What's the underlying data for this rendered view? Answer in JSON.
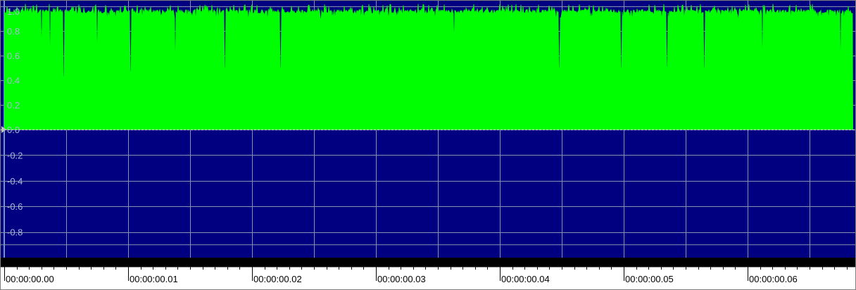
{
  "colors": {
    "background": "#000080",
    "waveform": "#00ff00",
    "grid": "#8890b0",
    "axis_label": "#a8b8d8",
    "ruler_bg": "#ffffff",
    "ruler_text": "#000000",
    "bar": "#000000"
  },
  "chart_data": {
    "type": "area",
    "ylim": [
      -1.0,
      1.0
    ],
    "xlim_seconds": [
      0.0,
      0.0685
    ],
    "y_ticks": [
      "1.0",
      "0.8",
      "0.6",
      "0.4",
      "0.2",
      "0.0",
      "-0.2",
      "-0.4",
      "-0.6",
      "-0.8"
    ],
    "y_tick_values": [
      1.0,
      0.8,
      0.6,
      0.4,
      0.2,
      0.0,
      -0.2,
      -0.4,
      -0.6,
      -0.8
    ],
    "x_ticks": [
      "00:00:00.00",
      "00:00:00.01",
      "00:00:00.02",
      "00:00:00.03",
      "00:00:00.04",
      "00:00:00.05",
      "00:00:00.06"
    ],
    "x_tick_values": [
      0.0,
      0.01,
      0.02,
      0.03,
      0.04,
      0.05,
      0.06
    ],
    "grid": true,
    "series": [
      {
        "values_note": "",
        "baseline": 0.0,
        "typical_level": 0.96,
        "dips": [
          {
            "t": 0.003,
            "v": 0.6
          },
          {
            "t": 0.0037,
            "v": 0.48
          },
          {
            "t": 0.0048,
            "v": 0.43
          },
          {
            "t": 0.0075,
            "v": 0.53
          },
          {
            "t": 0.0102,
            "v": 0.47
          },
          {
            "t": 0.0138,
            "v": 0.44
          },
          {
            "t": 0.0178,
            "v": 0.5
          },
          {
            "t": 0.0223,
            "v": 0.5
          },
          {
            "t": 0.0363,
            "v": 0.67
          },
          {
            "t": 0.0448,
            "v": 0.5
          },
          {
            "t": 0.0498,
            "v": 0.5
          },
          {
            "t": 0.0535,
            "v": 0.51
          },
          {
            "t": 0.0565,
            "v": 0.5
          },
          {
            "t": 0.0612,
            "v": 0.45
          },
          {
            "t": 0.0675,
            "v": 0.42
          }
        ]
      }
    ]
  }
}
